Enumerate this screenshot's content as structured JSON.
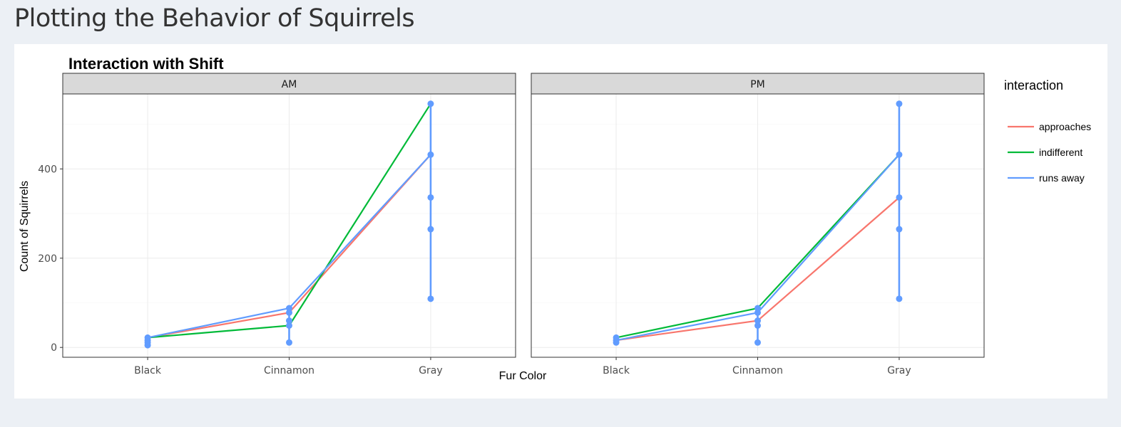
{
  "page": {
    "title": "Plotting the Behavior of Squirrels"
  },
  "chart_data": {
    "type": "line",
    "title": "Interaction with Shift",
    "xlabel": "Fur Color",
    "ylabel": "Count of Squirrels",
    "categories": [
      "Black",
      "Cinnamon",
      "Gray"
    ],
    "y_ticks": [
      0,
      200,
      400
    ],
    "ylim": [
      -22,
      568
    ],
    "grid": true,
    "legend": {
      "title": "interaction",
      "position": "right"
    },
    "colors": {
      "approaches": "#F8766D",
      "indifferent": "#00BA38",
      "runs away": "#619CFF"
    },
    "point_color": "#619CFF",
    "panels": [
      {
        "label": "AM",
        "series": [
          {
            "name": "approaches",
            "values": [
              22,
              78,
              432
            ]
          },
          {
            "name": "indifferent",
            "values": [
              22,
              49,
              546
            ]
          },
          {
            "name": "runs away",
            "values": [
              22,
              88,
              432
            ]
          }
        ],
        "points": [
          {
            "x": "Black",
            "y": 5
          },
          {
            "x": "Black",
            "y": 11
          },
          {
            "x": "Black",
            "y": 16
          },
          {
            "x": "Black",
            "y": 22
          },
          {
            "x": "Cinnamon",
            "y": 11
          },
          {
            "x": "Cinnamon",
            "y": 49
          },
          {
            "x": "Cinnamon",
            "y": 60
          },
          {
            "x": "Cinnamon",
            "y": 78
          },
          {
            "x": "Cinnamon",
            "y": 88
          },
          {
            "x": "Gray",
            "y": 109
          },
          {
            "x": "Gray",
            "y": 265
          },
          {
            "x": "Gray",
            "y": 336
          },
          {
            "x": "Gray",
            "y": 432
          },
          {
            "x": "Gray",
            "y": 546
          }
        ]
      },
      {
        "label": "PM",
        "series": [
          {
            "name": "approaches",
            "values": [
              16,
              60,
              336
            ]
          },
          {
            "name": "indifferent",
            "values": [
              22,
              88,
              432
            ]
          },
          {
            "name": "runs away",
            "values": [
              16,
              78,
              432
            ]
          }
        ],
        "points": [
          {
            "x": "Black",
            "y": 11
          },
          {
            "x": "Black",
            "y": 16
          },
          {
            "x": "Black",
            "y": 22
          },
          {
            "x": "Cinnamon",
            "y": 11
          },
          {
            "x": "Cinnamon",
            "y": 49
          },
          {
            "x": "Cinnamon",
            "y": 60
          },
          {
            "x": "Cinnamon",
            "y": 78
          },
          {
            "x": "Cinnamon",
            "y": 88
          },
          {
            "x": "Gray",
            "y": 109
          },
          {
            "x": "Gray",
            "y": 265
          },
          {
            "x": "Gray",
            "y": 336
          },
          {
            "x": "Gray",
            "y": 432
          },
          {
            "x": "Gray",
            "y": 546
          }
        ]
      }
    ]
  }
}
